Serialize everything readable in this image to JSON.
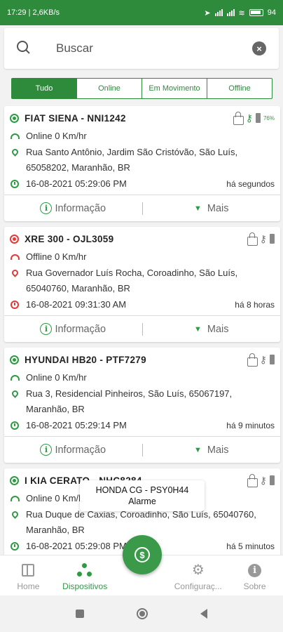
{
  "statusbar": {
    "time_info": "17:29 | 2,6KB/s",
    "battery": "94"
  },
  "search": {
    "placeholder": "Buscar"
  },
  "tabs": [
    "Tudo",
    "Online",
    "Em Movimento",
    "Offline"
  ],
  "cards": [
    {
      "title": "FIAT SIENA - NNI1242",
      "status": "online",
      "status_text": "Online 0 Km/hr",
      "address": "Rua Santo Antônio, Jardim São Cristóvão, São Luís, 65058202, Maranhão, BR",
      "datetime": "16-08-2021 05:29:06 PM",
      "ago": "há segundos",
      "battery_pct": "76%"
    },
    {
      "title": "XRE 300 - OJL3059",
      "status": "offline",
      "status_text": "Offline 0 Km/hr",
      "address": "Rua Governador Luís Rocha, Coroadinho, São Luís, 65040760, Maranhão, BR",
      "datetime": "16-08-2021 09:31:30 AM",
      "ago": "há 8 horas"
    },
    {
      "title": "HYUNDAI HB20 - PTF7279",
      "status": "online",
      "status_text": "Online 0 Km/hr",
      "address": "Rua 3, Residencial Pinheiros, São Luís, 65067197, Maranhão, BR",
      "datetime": "16-08-2021 05:29:14 PM",
      "ago": "há 9 minutos"
    },
    {
      "title": "I KIA CERATO - NHC8284",
      "status": "online",
      "status_text": "Online 0 Km/hr",
      "address": "Rua Duque de Caxias, Coroadinho, São Luís, 65040760, Maranhão, BR",
      "datetime": "16-08-2021 05:29:08 PM",
      "ago": "há 5 minutos"
    }
  ],
  "card_actions": {
    "info": "Informação",
    "more": "Mais"
  },
  "toast": {
    "line1": "HONDA CG - PSY0H44",
    "line2": "Alarme"
  },
  "bottomnav": [
    "Home",
    "Dispositivos",
    "Configuraç...",
    "Sobre"
  ],
  "colors": {
    "primary": "#2e8b3c",
    "online": "#2e9a43",
    "offline": "#e53935"
  }
}
